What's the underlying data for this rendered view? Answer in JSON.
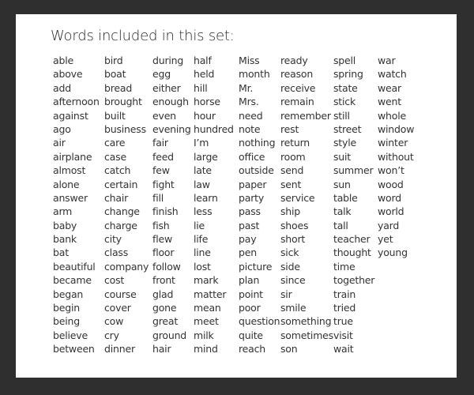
{
  "title": "Words included in this set:",
  "columns": [
    [
      "able",
      "above",
      "add",
      "afternoon",
      "against",
      "ago",
      "air",
      "airplane",
      "almost",
      "alone",
      "answer",
      "arm",
      "baby",
      "bank",
      "bat",
      "beautiful",
      "became",
      "began",
      "begin",
      "being",
      "believe",
      "between"
    ],
    [
      "bird",
      "boat",
      "bread",
      "brought",
      "built",
      "business",
      "care",
      "case",
      "catch",
      "certain",
      "chair",
      "change",
      "charge",
      "city",
      "class",
      "company",
      "cost",
      "course",
      "cover",
      "cow",
      "cry",
      "dinner"
    ],
    [
      "during",
      "egg",
      "either",
      "enough",
      "even",
      "evening",
      "fair",
      "feed",
      "few",
      "fight",
      "fill",
      "finish",
      "fish",
      "flew",
      "floor",
      "follow",
      "front",
      "glad",
      "gone",
      "great",
      "ground",
      "hair"
    ],
    [
      "half",
      "held",
      "hill",
      "horse",
      "hour",
      "hundred",
      "I’m",
      "large",
      "late",
      "law",
      "learn",
      "less",
      "lie",
      "life",
      "line",
      "lost",
      "mark",
      "matter",
      "mean",
      "meet",
      "milk",
      "mind"
    ],
    [
      "Miss",
      "month",
      "Mr.",
      "Mrs.",
      "need",
      "note",
      "nothing",
      "office",
      "outside",
      "paper",
      "party",
      "pass",
      "past",
      "pay",
      "pen",
      "picture",
      "plan",
      "point",
      "poor",
      "question",
      "quite",
      "reach"
    ],
    [
      "ready",
      "reason",
      "receive",
      "remain",
      "remember",
      "rest",
      "return",
      "room",
      "send",
      "sent",
      "service",
      "ship",
      "shoes",
      "short",
      "sick",
      "side",
      "since",
      "sir",
      "smile",
      "something",
      "sometimes",
      "son"
    ],
    [
      "spell",
      "spring",
      "state",
      "stick",
      "still",
      "street",
      "style",
      "suit",
      "summer",
      "sun",
      "table",
      "talk",
      "tall",
      "teacher",
      "thought",
      "time",
      "together",
      "train",
      "tried",
      "true",
      "visit",
      "wait"
    ],
    [
      "war",
      "watch",
      "wear",
      "went",
      "whole",
      "window",
      "winter",
      "without",
      "won’t",
      "wood",
      "word",
      "world",
      "yard",
      "yet",
      "young"
    ]
  ]
}
